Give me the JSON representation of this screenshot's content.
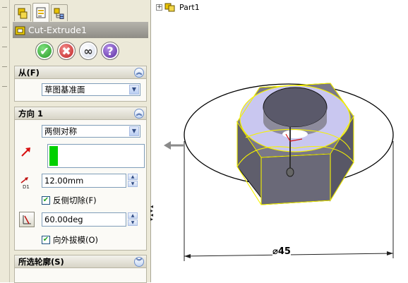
{
  "feature": {
    "title": "Cut-Extrude1"
  },
  "actions": {
    "ok": "✔",
    "cancel": "✖",
    "preview": "∞",
    "help": "?"
  },
  "from_group": {
    "header": "从(F)",
    "start_condition": "草图基准面"
  },
  "direction_group": {
    "header": "方向 1",
    "end_condition": "两侧对称",
    "depth": "12.00mm",
    "flip_side_to_cut": "反侧切除(F)",
    "flip_side_to_cut_checked": true,
    "draft_angle": "60.00deg",
    "draft_outward": "向外拔模(O)",
    "draft_outward_checked": true
  },
  "contours_group": {
    "header": "所选轮廓(S)"
  },
  "tree": {
    "root_label": "Part1",
    "expander": "+"
  },
  "dimension": {
    "text": "⌀45"
  },
  "colors": {
    "panel_bg": "#ece9d8",
    "title_bar": "#8f8d86",
    "ok_green": "#2eaa2e",
    "cancel_red": "#d42424",
    "help_purple": "#6a3aa8",
    "profile_green": "#00d000",
    "selection_yellow": "#f6f200",
    "nut_face": "#c9c7f0",
    "nut_body": "#6d6c7a"
  },
  "icons": {
    "tab1": "feature-manager-icon",
    "tab2": "property-manager-icon",
    "tab3": "configuration-manager-icon",
    "feature": "cut-extrude-icon",
    "direction_arrow": "direction-arrow-icon",
    "depth": "depth-d1-icon",
    "draft": "draft-angle-icon",
    "part": "part-icon"
  }
}
